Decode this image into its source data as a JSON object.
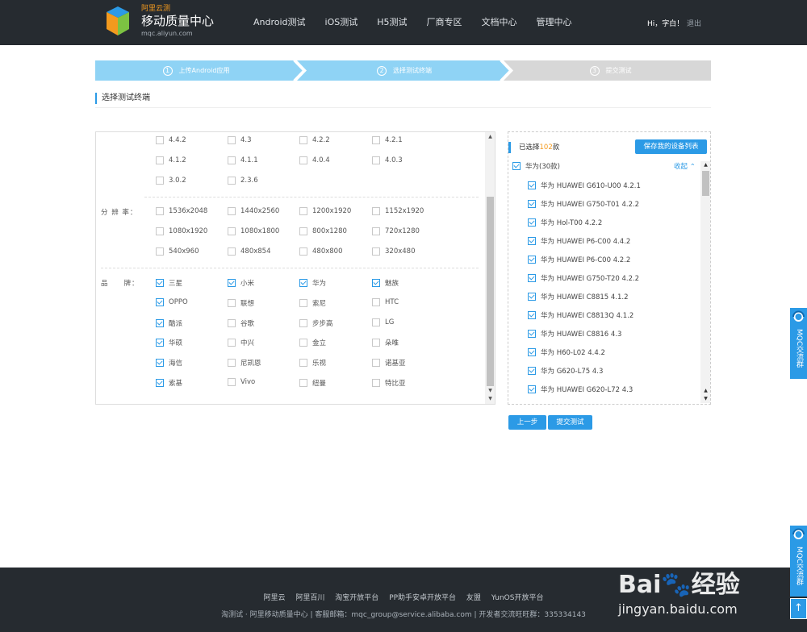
{
  "header": {
    "brand_small": "阿里云测",
    "brand_title": "移动质量中心",
    "brand_url": "mqc.aliyun.com",
    "nav": [
      "Android测试",
      "iOS测试",
      "H5测试",
      "厂商专区",
      "文档中心",
      "管理中心"
    ],
    "greeting": "Hi，字白！",
    "logout": "退出"
  },
  "steps": [
    {
      "num": "1",
      "label": "上传Android应用"
    },
    {
      "num": "2",
      "label": "选择测试终端"
    },
    {
      "num": "3",
      "label": "提交测试"
    }
  ],
  "section_title": "选择测试终端",
  "filters": {
    "versions": [
      [
        "4.4.2",
        "4.3",
        "4.2.2",
        "4.2.1"
      ],
      [
        "4.1.2",
        "4.1.1",
        "4.0.4",
        "4.0.3"
      ],
      [
        "3.0.2",
        "2.3.6"
      ]
    ],
    "resolution_label": "分 辨 率：",
    "resolutions": [
      [
        "1536x2048",
        "1440x2560",
        "1200x1920",
        "1152x1920"
      ],
      [
        "1080x1920",
        "1080x1800",
        "800x1280",
        "720x1280"
      ],
      [
        "540x960",
        "480x854",
        "480x800",
        "320x480"
      ]
    ],
    "brand_label": "品　　牌：",
    "brands": [
      [
        {
          "name": "三星",
          "checked": true
        },
        {
          "name": "小米",
          "checked": true
        },
        {
          "name": "华为",
          "checked": true
        },
        {
          "name": "魅族",
          "checked": true
        }
      ],
      [
        {
          "name": "OPPO",
          "checked": true
        },
        {
          "name": "联想",
          "checked": false
        },
        {
          "name": "索尼",
          "checked": false
        },
        {
          "name": "HTC",
          "checked": false
        }
      ],
      [
        {
          "name": "酷派",
          "checked": true
        },
        {
          "name": "谷歌",
          "checked": false
        },
        {
          "name": "步步高",
          "checked": false
        },
        {
          "name": "LG",
          "checked": false
        }
      ],
      [
        {
          "name": "华硕",
          "checked": true
        },
        {
          "name": "中兴",
          "checked": false
        },
        {
          "name": "金立",
          "checked": false
        },
        {
          "name": "朵唯",
          "checked": false
        }
      ],
      [
        {
          "name": "海信",
          "checked": true
        },
        {
          "name": "尼凯恩",
          "checked": false
        },
        {
          "name": "乐视",
          "checked": false
        },
        {
          "name": "诺基亚",
          "checked": false
        }
      ],
      [
        {
          "name": "索基",
          "checked": true
        },
        {
          "name": "Vivo",
          "checked": false
        },
        {
          "name": "纽曼",
          "checked": false
        },
        {
          "name": "特比亚",
          "checked": false
        }
      ]
    ]
  },
  "selected": {
    "prefix": "已选择",
    "count": "102",
    "suffix": "款",
    "save_button": "保存我的设备列表",
    "group_label": "华为(30款)",
    "collapse": "收起",
    "devices": [
      "华为 HUAWEI G610-U00 4.2.1",
      "华为 HUAWEI G750-T01 4.2.2",
      "华为 Hol-T00 4.2.2",
      "华为 HUAWEI P6-C00 4.4.2",
      "华为 HUAWEI P6-C00 4.2.2",
      "华为 HUAWEI G750-T20 4.2.2",
      "华为 HUAWEI C8815 4.1.2",
      "华为 HUAWEI C8813Q 4.1.2",
      "华为 HUAWEI C8816 4.3",
      "华为 H60-L02 4.4.2",
      "华为 G620-L75 4.3",
      "华为 HUAWEI G620-L72 4.3"
    ]
  },
  "buttons": {
    "prev": "上一步",
    "submit": "提交测试"
  },
  "footer": {
    "links": [
      "阿里云",
      "阿里百川",
      "淘宝开放平台",
      "PP助手安卓开放平台",
      "友盟",
      "YunOS开放平台"
    ],
    "copyright": "淘测试 · 阿里移动质量中心 | 客服邮箱：mqc_group@service.alibaba.com | 开发者交流旺旺群：335334143"
  },
  "side_widget": "MQC交流群",
  "watermark": {
    "main": "Bai🐾经验",
    "sub": "jingyan.baidu.com"
  },
  "colors": {
    "accent": "#2b9ae6",
    "header_bg": "#262b30",
    "step_active": "#8fd3f5",
    "step_inactive": "#d7d7d7",
    "count": "#f39a1e"
  }
}
